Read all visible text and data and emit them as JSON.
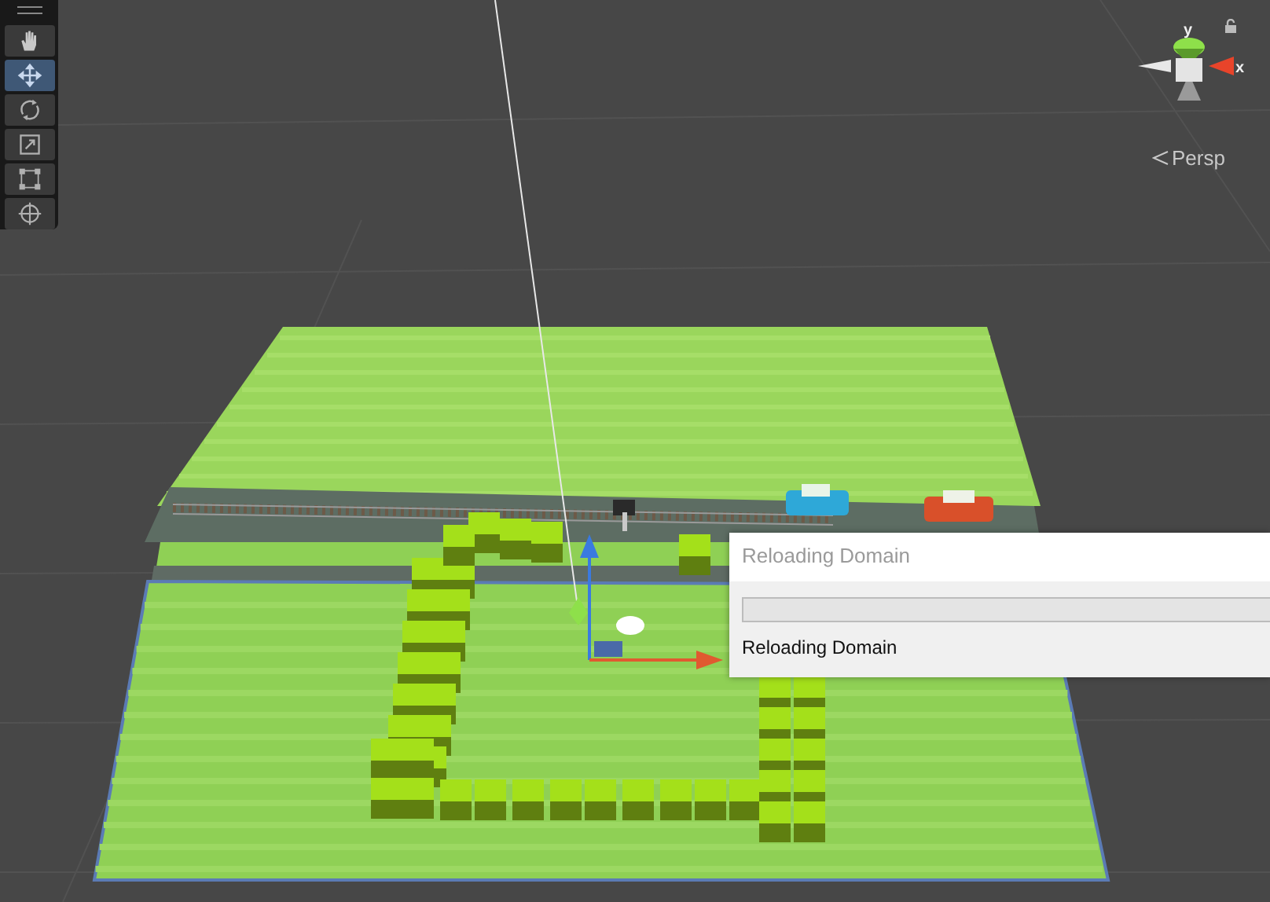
{
  "toolbar": {
    "tools": [
      {
        "kind": "hand",
        "selected": false
      },
      {
        "kind": "move",
        "selected": true
      },
      {
        "kind": "rotate",
        "selected": false
      },
      {
        "kind": "scale",
        "selected": false
      },
      {
        "kind": "rect",
        "selected": false
      },
      {
        "kind": "transform",
        "selected": false
      }
    ]
  },
  "gizmo": {
    "axis_labels": [
      "y",
      "x"
    ],
    "projection": "Persp"
  },
  "dialog": {
    "title": "Reloading Domain",
    "progress": {
      "level": 0
    },
    "message": "Reloading Domain"
  }
}
